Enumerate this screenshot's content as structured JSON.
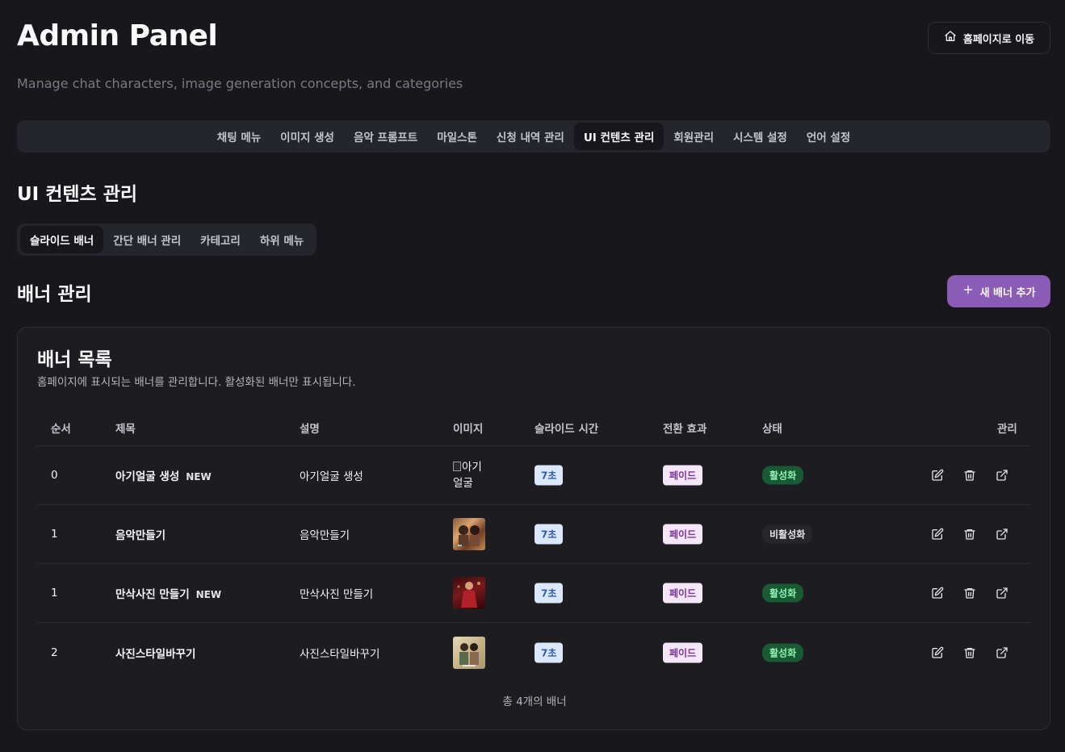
{
  "header": {
    "title": "Admin Panel",
    "subtitle": "Manage chat characters, image generation concepts, and categories",
    "home_button_label": "홈페이지로 이동"
  },
  "main_nav": {
    "tabs": [
      {
        "label": "채팅 메뉴",
        "active": false
      },
      {
        "label": "이미지 생성",
        "active": false
      },
      {
        "label": "음악 프롬프트",
        "active": false
      },
      {
        "label": "마일스톤",
        "active": false
      },
      {
        "label": "신청 내역 관리",
        "active": false
      },
      {
        "label": "UI 컨텐츠 관리",
        "active": true
      },
      {
        "label": "회원관리",
        "active": false
      },
      {
        "label": "시스템 설정",
        "active": false
      },
      {
        "label": "언어 설정",
        "active": false
      }
    ]
  },
  "section": {
    "title": "UI 컨텐츠 관리",
    "sub_tabs": [
      {
        "label": "슬라이드 배너",
        "active": true
      },
      {
        "label": "간단 배너 관리",
        "active": false
      },
      {
        "label": "카테고리",
        "active": false
      },
      {
        "label": "하위 메뉴",
        "active": false
      }
    ],
    "banner_mgmt_title": "배너 관리",
    "add_banner_label": "새 배너 추가"
  },
  "card": {
    "title": "배너 목록",
    "description": "홈페이지에 표시되는 배너를 관리합니다. 활성화된 배너만 표시됩니다.",
    "columns": {
      "order": "순서",
      "title": "제목",
      "description": "설명",
      "image": "이미지",
      "slide_time": "슬라이드 시간",
      "transition": "전환 효과",
      "status": "상태",
      "actions": "관리"
    },
    "rows": [
      {
        "order": "0",
        "title": "아기얼굴 생성",
        "new": "NEW",
        "description": "아기얼굴 생성",
        "image_alt": "아기얼굴",
        "image_broken": true,
        "duration": "7초",
        "effect": "페이드",
        "status": "활성화",
        "active": true
      },
      {
        "order": "1",
        "title": "음악만들기",
        "new": "",
        "description": "음악만들기",
        "image_alt": "",
        "image_broken": false,
        "duration": "7초",
        "effect": "페이드",
        "status": "비활성화",
        "active": false
      },
      {
        "order": "1",
        "title": "만삭사진 만들기",
        "new": "NEW",
        "description": "만삭사진 만들기",
        "image_alt": "",
        "image_broken": false,
        "duration": "7초",
        "effect": "페이드",
        "status": "활성화",
        "active": true
      },
      {
        "order": "2",
        "title": "사진스타일바꾸기",
        "new": "",
        "description": "사진스타일바꾸기",
        "image_alt": "",
        "image_broken": false,
        "duration": "7초",
        "effect": "페이드",
        "status": "활성화",
        "active": true
      }
    ],
    "footer": "총 4개의 배너"
  },
  "colors": {
    "background": "#17171c",
    "accent": "#8b5cb6",
    "active_status": "#175a33",
    "duration_badge": "#dbe8fb",
    "effect_badge": "#f5e6fa"
  },
  "icons": {
    "home": "home-icon",
    "add": "plus-icon",
    "edit": "edit-icon",
    "delete": "trash-icon",
    "open": "external-link-icon"
  }
}
